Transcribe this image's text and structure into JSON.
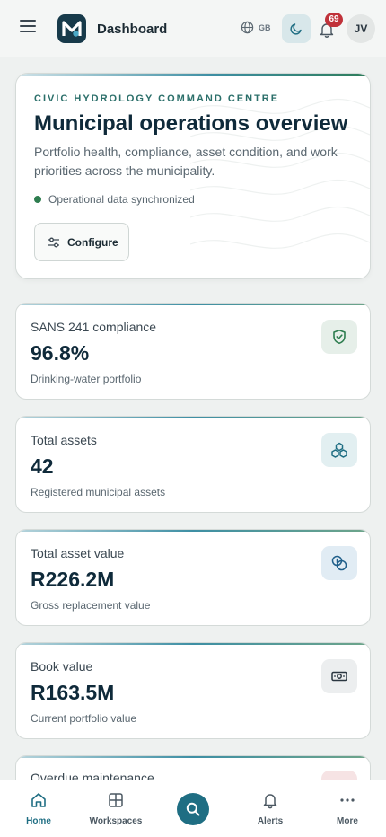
{
  "header": {
    "title": "Dashboard",
    "language": "GB",
    "notification_count": "69",
    "user_initials": "JV"
  },
  "hero": {
    "kicker": "CIVIC HYDROLOGY COMMAND CENTRE",
    "title": "Municipal operations overview",
    "description": "Portfolio health, compliance, asset condition, and work priorities across the municipality.",
    "sync_status": "Operational data synchronized",
    "configure_label": "Configure"
  },
  "kpis": [
    {
      "label": "SANS 241 compliance",
      "value": "96.8%",
      "sub": "Drinking-water portfolio",
      "icon": "shield-check-icon",
      "icon_bg": "#e6efe9",
      "icon_color": "#2e7d4f"
    },
    {
      "label": "Total assets",
      "value": "42",
      "sub": "Registered municipal assets",
      "icon": "cubes-icon",
      "icon_bg": "#e2eff1",
      "icon_color": "#1f6e83"
    },
    {
      "label": "Total asset value",
      "value": "R226.2M",
      "sub": "Gross replacement value",
      "icon": "coins-icon",
      "icon_bg": "#e1ecf4",
      "icon_color": "#1f5f8a"
    },
    {
      "label": "Book value",
      "value": "R163.5M",
      "sub": "Current portfolio value",
      "icon": "banknote-icon",
      "icon_bg": "#eceeef",
      "icon_color": "#2a3640"
    },
    {
      "label": "Overdue maintenance",
      "value": "",
      "sub": "",
      "icon": "alert-icon",
      "icon_bg": "#f6e3e4",
      "icon_color": "#c0323a"
    }
  ],
  "nav": {
    "home": "Home",
    "workspaces": "Workspaces",
    "alerts": "Alerts",
    "more": "More"
  },
  "colors": {
    "accent": "#1f6e83",
    "brand_dark": "#173a4a",
    "success": "#2e7d4f",
    "danger": "#c0323a"
  }
}
